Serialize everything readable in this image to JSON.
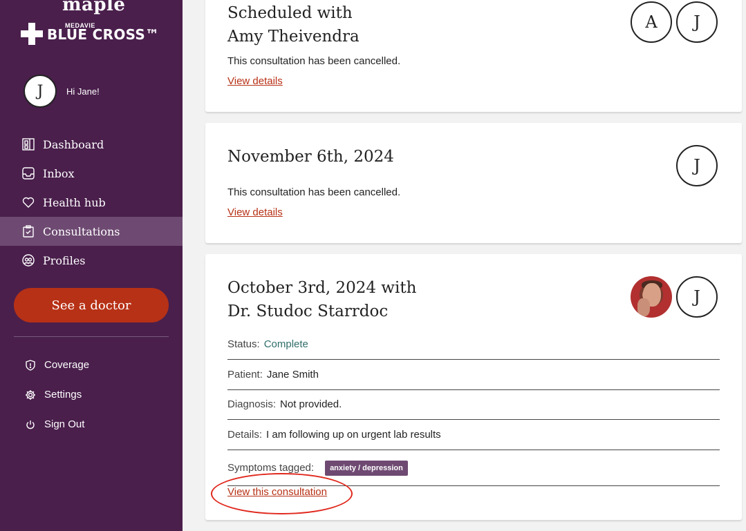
{
  "brand": {
    "top": "maple",
    "sub_small": "MEDAVIE",
    "sub_big": "BLUE CROSS™"
  },
  "user": {
    "initial": "J",
    "greeting": "Hi Jane!"
  },
  "nav": [
    {
      "label": "Dashboard",
      "icon": "dashboard-icon"
    },
    {
      "label": "Inbox",
      "icon": "inbox-icon"
    },
    {
      "label": "Health hub",
      "icon": "heart-icon"
    },
    {
      "label": "Consultations",
      "icon": "clipboard-icon",
      "active": true
    },
    {
      "label": "Profiles",
      "icon": "profiles-icon"
    }
  ],
  "cta": {
    "label": "See a doctor"
  },
  "sub_nav": [
    {
      "label": "Coverage",
      "icon": "shield-icon"
    },
    {
      "label": "Settings",
      "icon": "gear-icon"
    },
    {
      "label": "Sign Out",
      "icon": "power-icon"
    }
  ],
  "cards": [
    {
      "title_line1": "Scheduled with",
      "title_line2": "Amy Theivendra",
      "text": "This consultation has been cancelled.",
      "link": "View details",
      "avatars": [
        "A",
        "J"
      ]
    },
    {
      "title_line1": "November 6th, 2024",
      "text": "This consultation has been cancelled.",
      "link": "View details",
      "avatars": [
        "J"
      ]
    },
    {
      "title_line1": "October 3rd, 2024 with",
      "title_line2": "Dr. Studoc Starrdoc",
      "avatars": [
        "J"
      ],
      "status_label": "Status:",
      "status_value": "Complete",
      "patient_label": "Patient:",
      "patient_value": "Jane Smith",
      "diagnosis_label": "Diagnosis:",
      "diagnosis_value": "Not provided.",
      "details_label": "Details:",
      "details_value": "I am following up on urgent lab results",
      "symptoms_label": "Symptoms tagged:",
      "symptom_tag": "anxiety / depression",
      "link": "View this consultation"
    }
  ],
  "colors": {
    "sidebar": "#4a1f4c",
    "accent": "#b73116",
    "status_green": "#2f6e6a",
    "tag": "#6e4a72",
    "highlight": "#e0281d"
  }
}
